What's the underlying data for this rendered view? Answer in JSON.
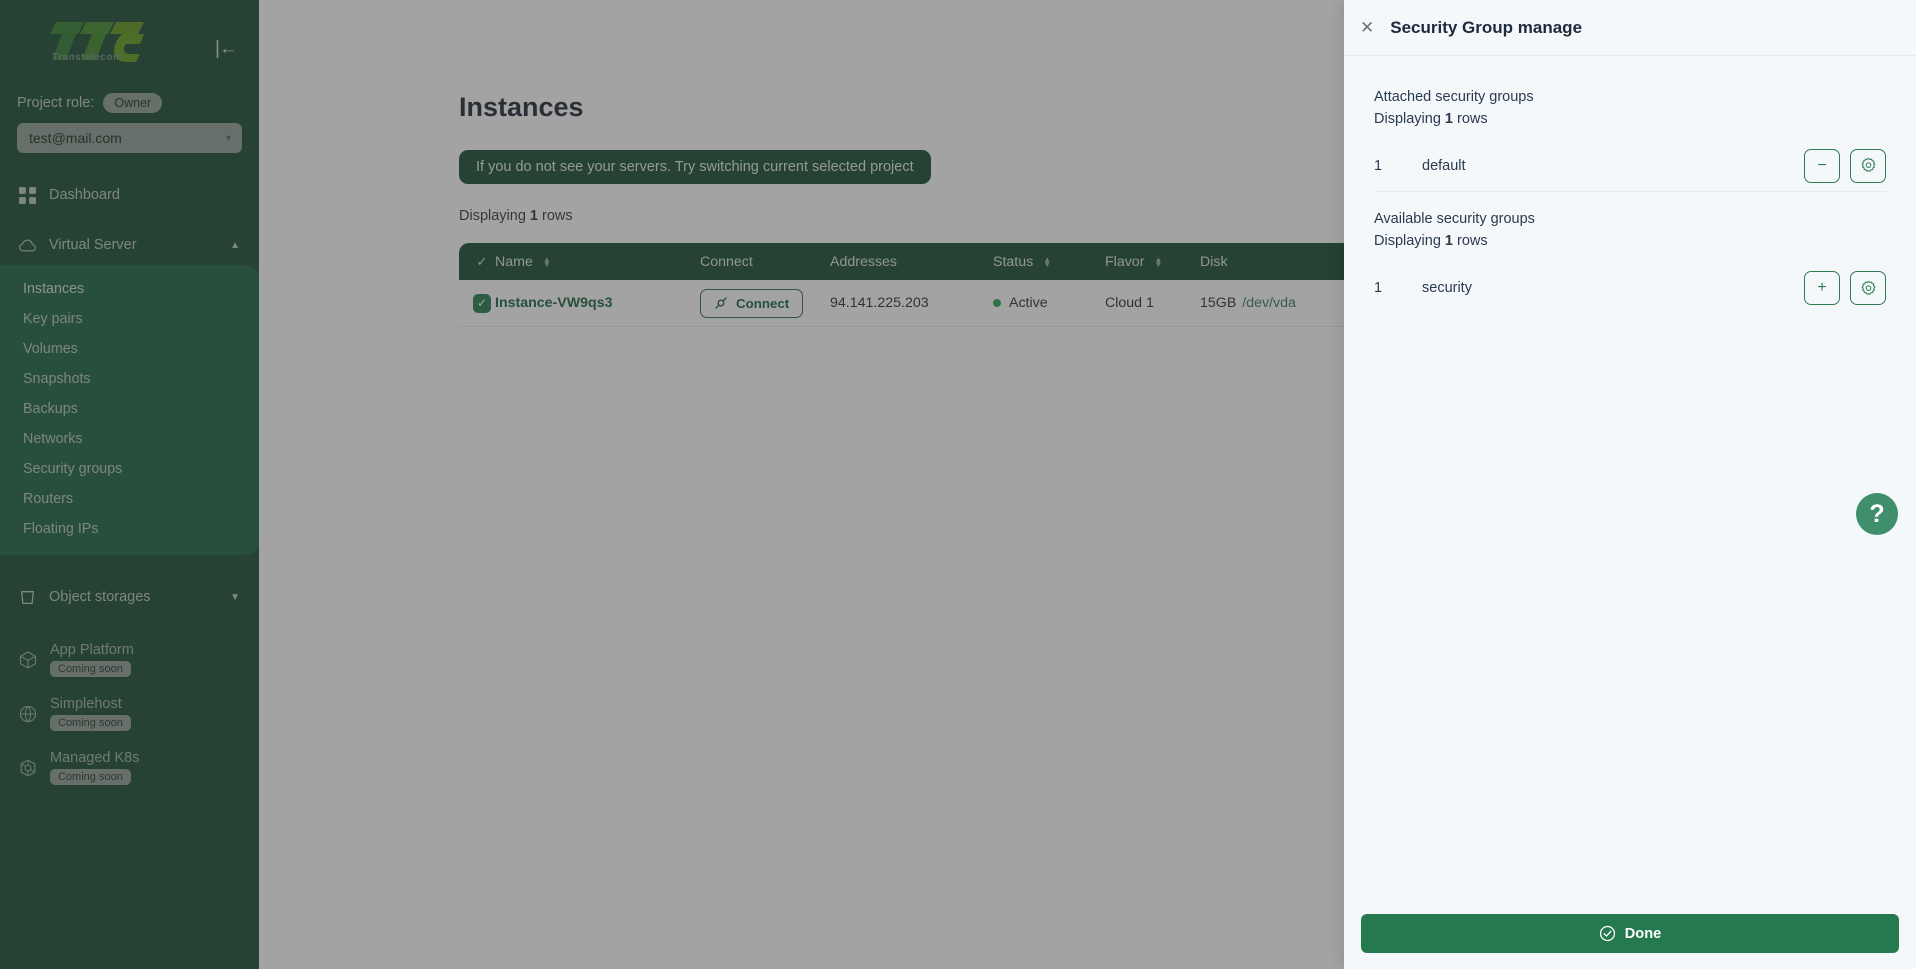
{
  "sidebar": {
    "logo_text": "TTC",
    "logo_subtitle": "Transtelecom",
    "collapse_glyph": "|←",
    "role_label": "Project role:",
    "role_badge": "Owner",
    "project_value": "test@mail.com",
    "dashboard": "Dashboard",
    "virtual_server": "Virtual Server",
    "virtual_server_items": [
      {
        "label": "Instances",
        "active": true
      },
      {
        "label": "Key pairs",
        "active": false
      },
      {
        "label": "Volumes",
        "active": false
      },
      {
        "label": "Snapshots",
        "active": false
      },
      {
        "label": "Backups",
        "active": false
      },
      {
        "label": "Networks",
        "active": false
      },
      {
        "label": "Security groups",
        "active": false
      },
      {
        "label": "Routers",
        "active": false
      },
      {
        "label": "Floating IPs",
        "active": false
      }
    ],
    "object_storages": "Object storages",
    "coming_items": [
      {
        "label": "App Platform",
        "badge": "Coming soon"
      },
      {
        "label": "Simplehost",
        "badge": "Coming soon"
      },
      {
        "label": "Managed K8s",
        "badge": "Coming soon"
      }
    ]
  },
  "main": {
    "page_title": "Instances",
    "hint_banner": "If you do not see your servers. Try switching current selected project",
    "rows_prefix": "Displaying ",
    "rows_count": "1",
    "rows_suffix": " rows",
    "table": {
      "headers": {
        "name": "Name",
        "connect": "Connect",
        "addresses": "Addresses",
        "status": "Status",
        "flavor": "Flavor",
        "disk": "Disk"
      },
      "row": {
        "name": "Instance-VW9qs3",
        "connect_label": "Connect",
        "address": "94.141.225.203",
        "status": "Active",
        "flavor": "Cloud 1",
        "disk_size": "15GB",
        "disk_path": "/dev/vda"
      }
    }
  },
  "panel": {
    "title": "Security Group manage",
    "attached_label": "Attached security groups",
    "attached_rows_prefix": "Displaying ",
    "attached_rows_count": "1",
    "attached_rows_suffix": " rows",
    "attached": [
      {
        "index": "1",
        "name": "default",
        "action": "−"
      }
    ],
    "available_label": "Available security groups",
    "available_rows_prefix": "Displaying ",
    "available_rows_count": "1",
    "available_rows_suffix": " rows",
    "available": [
      {
        "index": "1",
        "name": "security",
        "action": "+"
      }
    ],
    "done_label": "Done"
  },
  "help": {
    "glyph": "?"
  },
  "colors": {
    "sidebar_bg": "#11482f",
    "subnav_bg": "#17603c",
    "accent_green": "#25794f",
    "panel_bg": "#f5f8fa",
    "status_active": "#24a34f"
  }
}
